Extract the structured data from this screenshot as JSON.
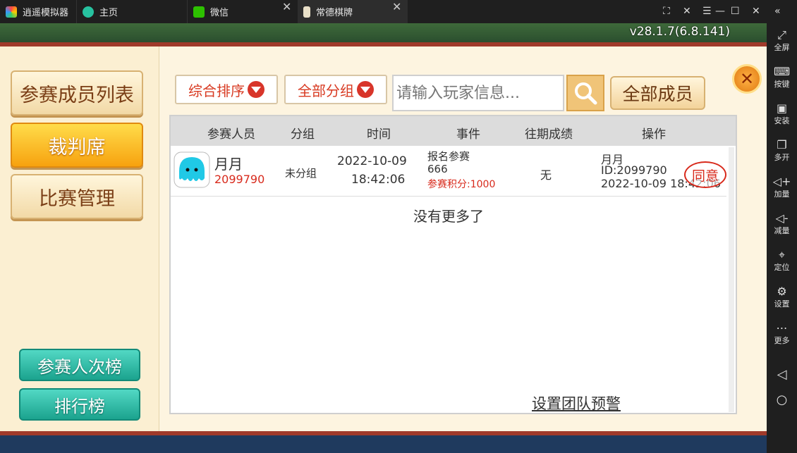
{
  "titlebar": {
    "app_name": "逍遥模拟器",
    "tabs": [
      {
        "label": "主页",
        "icon": "home-icon"
      },
      {
        "label": "微信",
        "icon": "wechat-icon"
      },
      {
        "label": "常德棋牌",
        "icon": "game-icon"
      }
    ],
    "window_controls": [
      "restore-icon",
      "close-icon",
      "menu-icon",
      "minimize-icon",
      "maximize-icon",
      "close-icon",
      "collapse-icon"
    ]
  },
  "game": {
    "version": "v28.1.7(6.8.141)",
    "left_nav": [
      "参赛成员列表",
      "裁判席",
      "比赛管理"
    ],
    "left_nav_active": 1,
    "bottom_buttons": [
      "参赛人次榜",
      "排行榜"
    ],
    "filters": {
      "sort": "综合排序",
      "group": "全部分组"
    },
    "search_placeholder": "请输入玩家信息...",
    "all_members_label": "全部成员",
    "table": {
      "headers": [
        "参赛人员",
        "分组",
        "时间",
        "事件",
        "往期成绩",
        "操作"
      ],
      "rows": [
        {
          "name": "月月",
          "id": "2099790",
          "group": "未分组",
          "date": "2022-10-09",
          "time": "18:42:06",
          "event_line1": "报名参赛",
          "event_line2": "666",
          "event_line3": "参赛积分:1000",
          "history": "无",
          "op_name": "月月",
          "op_id": "ID:2099790",
          "op_time": "2022-10-09 18:42:06",
          "action": "同意"
        }
      ],
      "empty_text": "没有更多了"
    },
    "warning_link": "设置团队预警"
  },
  "sidebar": [
    {
      "label": "全屏",
      "icon": "fullscreen-icon"
    },
    {
      "label": "按键",
      "icon": "keyboard-icon"
    },
    {
      "label": "安装",
      "icon": "apk-icon"
    },
    {
      "label": "多开",
      "icon": "multi-instance-icon"
    },
    {
      "label": "加量",
      "icon": "volume-up-icon"
    },
    {
      "label": "减量",
      "icon": "volume-down-icon"
    },
    {
      "label": "定位",
      "icon": "location-icon"
    },
    {
      "label": "设置",
      "icon": "gear-icon"
    },
    {
      "label": "更多",
      "icon": "more-icon"
    }
  ]
}
